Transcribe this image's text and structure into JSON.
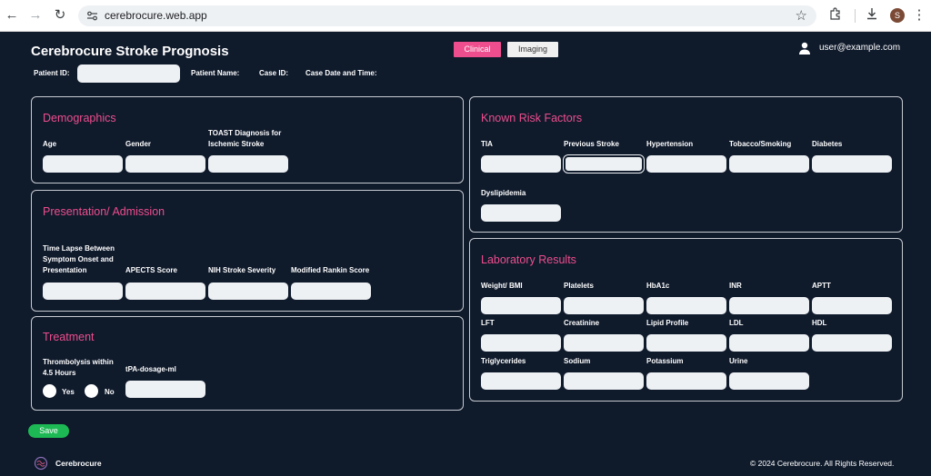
{
  "browser": {
    "url": "cerebrocure.web.app",
    "avatar_initial": "S"
  },
  "header": {
    "title": "Cerebrocure Stroke Prognosis",
    "tabs": [
      "Clinical",
      "Imaging"
    ],
    "user_email": "user@example.com"
  },
  "meta": {
    "patient_id_label": "Patient ID:",
    "patient_name_label": "Patient Name:",
    "case_id_label": "Case ID:",
    "case_datetime_label": "Case Date and Time:"
  },
  "demographics": {
    "title": "Demographics",
    "fields": [
      "Age",
      "Gender",
      "TOAST Diagnosis for Ischemic Stroke"
    ]
  },
  "presentation": {
    "title": "Presentation/ Admission",
    "fields": [
      "Time Lapse Between Symptom Onset and Presentation",
      "APECTS Score",
      "NIH Stroke Severity",
      "Modified Rankin Score"
    ]
  },
  "treatment": {
    "title": "Treatment",
    "thrombolysis_label": "Thrombolysis within 4.5 Hours",
    "yes_label": "Yes",
    "no_label": "No",
    "tpa_label": "tPA-dosage-ml"
  },
  "risk_factors": {
    "title": "Known Risk Factors",
    "fields": [
      "TIA",
      "Previous Stroke",
      "Hypertension",
      "Tobacco/Smoking",
      "Diabetes",
      "Dyslipidemia"
    ]
  },
  "lab": {
    "title": "Laboratory Results",
    "fields": [
      "Weight/ BMI",
      "Platelets",
      "HbA1c",
      "INR",
      "APTT",
      "LFT",
      "Creatinine",
      "Lipid Profile",
      "LDL",
      "HDL",
      "Triglycerides",
      "Sodium",
      "Potassium",
      "Urine"
    ]
  },
  "actions": {
    "save_label": "Save"
  },
  "footer": {
    "brand": "Cerebrocure",
    "copyright": "© 2024 Cerebrocure. All Rights Reserved."
  },
  "colors": {
    "accent": "#ee4e8e",
    "background": "#0f1a2b",
    "save": "#1db954"
  }
}
